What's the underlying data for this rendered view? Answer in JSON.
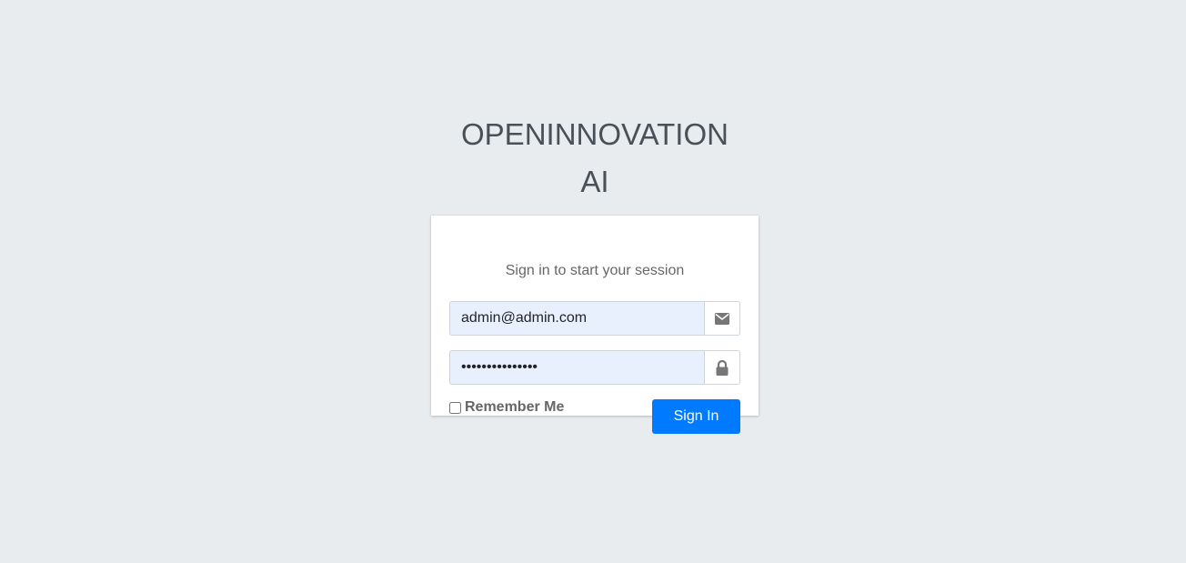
{
  "logo": {
    "line1": "OPENINNOVATION",
    "line2": "AI"
  },
  "login": {
    "message": "Sign in to start your session",
    "email_value": "admin@admin.com",
    "password_value": "•••••••••••••••",
    "remember_label": "Remember Me",
    "submit_label": "Sign In"
  },
  "icons": {
    "email": "envelope-icon",
    "password": "lock-icon"
  },
  "colors": {
    "background": "#e9ecef",
    "primary": "#007bff",
    "autofill": "#e8f0fe"
  }
}
